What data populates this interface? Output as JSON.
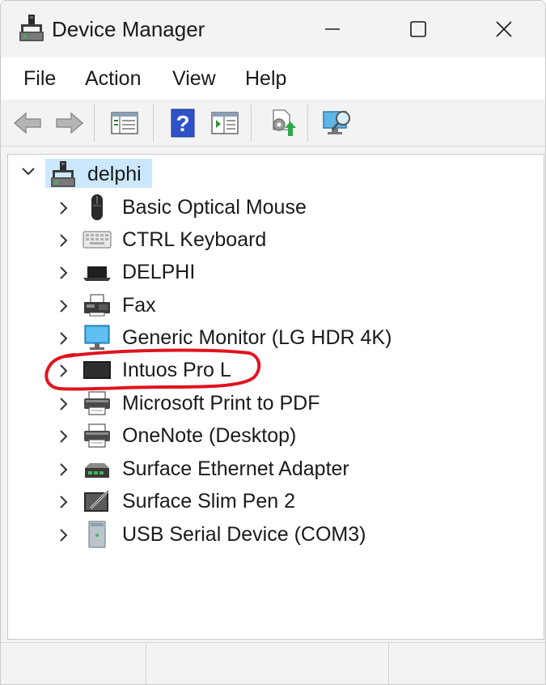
{
  "window": {
    "title": "Device Manager",
    "icon": "device-manager-icon",
    "controls": {
      "minimize": "minimize-icon",
      "maximize": "maximize-icon",
      "close": "close-icon"
    }
  },
  "menu": {
    "file": "File",
    "action": "Action",
    "view": "View",
    "help": "Help"
  },
  "toolbar": {
    "buttons": [
      "back-icon",
      "forward-icon",
      "show-hide-console-tree-icon",
      "help-icon",
      "properties-pane-icon",
      "update-driver-icon",
      "scan-hardware-icon"
    ]
  },
  "tree": {
    "root": {
      "label": "delphi",
      "icon": "computer-icon",
      "expanded": true,
      "selected": true
    },
    "items": [
      {
        "label": "Basic Optical Mouse",
        "icon": "mouse-icon"
      },
      {
        "label": "CTRL Keyboard",
        "icon": "keyboard-icon"
      },
      {
        "label": "DELPHI",
        "icon": "laptop-icon"
      },
      {
        "label": "Fax",
        "icon": "fax-icon"
      },
      {
        "label": "Generic Monitor (LG HDR 4K)",
        "icon": "monitor-icon"
      },
      {
        "label": "Intuos Pro L",
        "icon": "tablet-icon",
        "annotated": true
      },
      {
        "label": "Microsoft Print to PDF",
        "icon": "printer-icon"
      },
      {
        "label": "OneNote (Desktop)",
        "icon": "printer-icon"
      },
      {
        "label": "Surface Ethernet Adapter",
        "icon": "network-adapter-icon"
      },
      {
        "label": "Surface Slim Pen 2",
        "icon": "pen-tablet-icon"
      },
      {
        "label": "USB Serial Device (COM3)",
        "icon": "usb-device-icon"
      }
    ]
  },
  "colors": {
    "selection": "#cce8ff",
    "annotation": "#e0141e",
    "chrome": "#f3f3f3"
  }
}
